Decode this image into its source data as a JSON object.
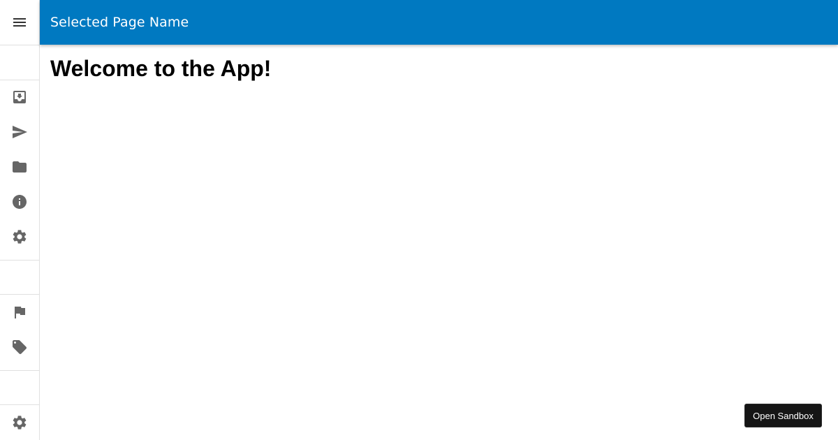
{
  "appbar": {
    "title": "Selected Page Name",
    "color": "#0079c1"
  },
  "sidebar": {
    "menu_icon": "menu-icon",
    "primary_items": [
      {
        "icon": "inbox-download-icon"
      },
      {
        "icon": "send-icon"
      },
      {
        "icon": "folder-icon"
      },
      {
        "icon": "info-icon"
      },
      {
        "icon": "settings-icon"
      }
    ],
    "secondary_items": [
      {
        "icon": "flag-icon"
      },
      {
        "icon": "tag-icon"
      }
    ],
    "footer_items": [
      {
        "icon": "settings-icon"
      }
    ]
  },
  "main": {
    "heading": "Welcome to the App!"
  },
  "sandbox_button": {
    "label": "Open Sandbox"
  }
}
